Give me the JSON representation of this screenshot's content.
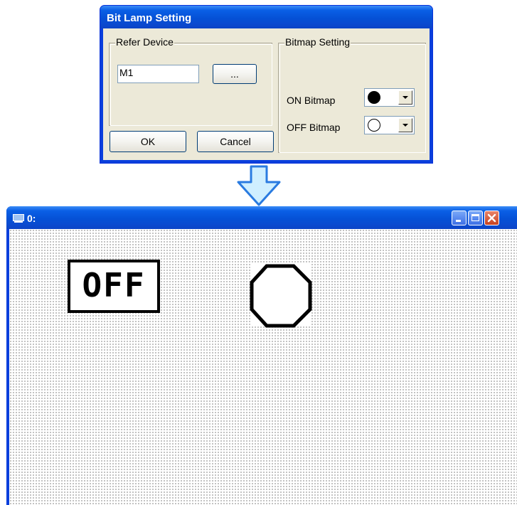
{
  "dialog": {
    "title": "Bit Lamp Setting",
    "refer_device": {
      "legend": "Refer Device",
      "value": "M1",
      "browse_label": "..."
    },
    "ok_label": "OK",
    "cancel_label": "Cancel",
    "bitmap_setting": {
      "legend": "Bitmap Setting",
      "on_label": "ON Bitmap",
      "on_icon": "filled-circle-icon",
      "off_label": "OFF Bitmap",
      "off_icon": "empty-circle-icon"
    }
  },
  "arrow_icon": "down-arrow-icon",
  "window": {
    "title": "0:",
    "buttons": [
      "minimize",
      "maximize",
      "close"
    ],
    "off_label": "OFF",
    "lamp_icon": "empty-circle-icon"
  },
  "colors": {
    "title_blue": "#0a5fe6",
    "dialog_face": "#ece9d8",
    "arrow_fill": "#cfefff",
    "arrow_outline": "#2a7be0"
  }
}
